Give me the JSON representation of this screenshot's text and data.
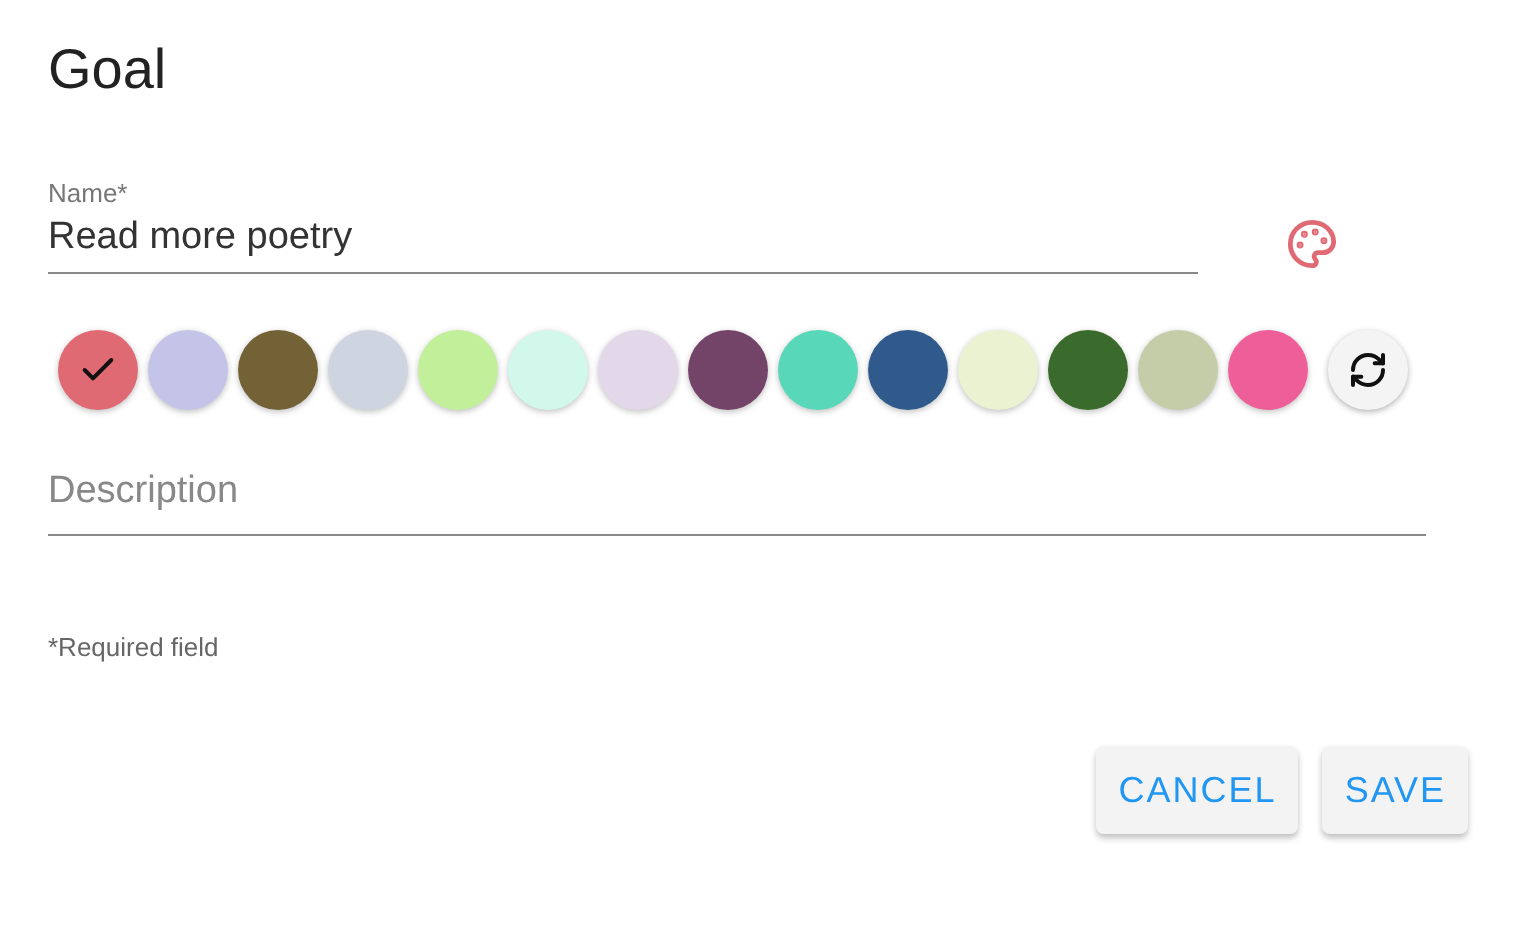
{
  "title": "Goal",
  "name_field": {
    "label": "Name*",
    "value": "Read more poetry"
  },
  "swatches": [
    {
      "color": "#e06a74",
      "selected": true
    },
    {
      "color": "#c4c4e8",
      "selected": false
    },
    {
      "color": "#746237",
      "selected": false
    },
    {
      "color": "#ced5e0",
      "selected": false
    },
    {
      "color": "#c2f09a",
      "selected": false
    },
    {
      "color": "#d2f8ec",
      "selected": false
    },
    {
      "color": "#e2d8ea",
      "selected": false
    },
    {
      "color": "#744468",
      "selected": false
    },
    {
      "color": "#58d8b8",
      "selected": false
    },
    {
      "color": "#305a8c",
      "selected": false
    },
    {
      "color": "#eaf2d2",
      "selected": false
    },
    {
      "color": "#3a6a2c",
      "selected": false
    },
    {
      "color": "#c4cca8",
      "selected": false
    },
    {
      "color": "#ee5e98",
      "selected": false
    }
  ],
  "description_field": {
    "placeholder": "Description"
  },
  "note": "*Required field",
  "buttons": [
    "CANCEL",
    "SAVE"
  ]
}
